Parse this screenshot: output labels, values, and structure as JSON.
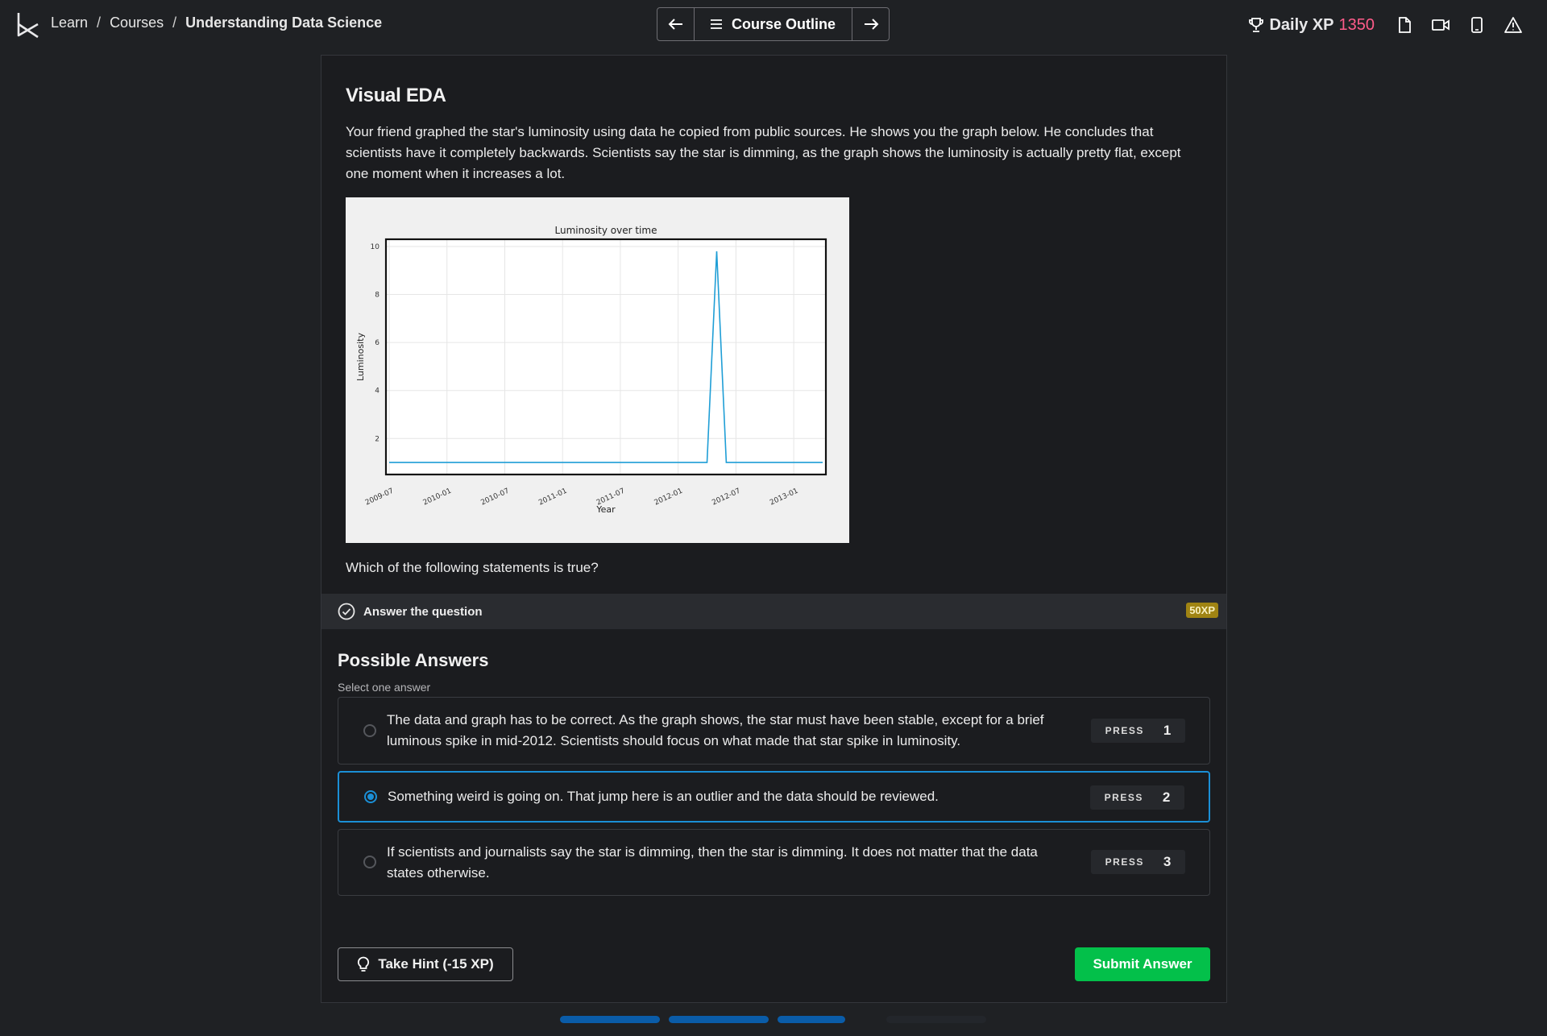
{
  "breadcrumb": {
    "items": [
      "Learn",
      "Courses"
    ],
    "current": "Understanding Data Science",
    "separator": "/"
  },
  "nav": {
    "outline_label": "Course Outline",
    "prev": "←",
    "next": "→"
  },
  "xp": {
    "label": "Daily XP",
    "value": "1350"
  },
  "exercise": {
    "title": "Visual EDA",
    "description": "Your friend graphed the star's luminosity using data he copied from public sources. He shows you the graph below. He concludes that scientists have it completely backwards. Scientists say the star is dimming, as the graph shows the luminosity is actually pretty flat, except one moment when it increases a lot.",
    "question": "Which of the following statements is true?"
  },
  "task": {
    "label": "Answer the question",
    "xp": "50XP"
  },
  "answers_section": {
    "title": "Possible Answers",
    "subtitle": "Select one answer"
  },
  "answers": [
    {
      "text": "The data and graph has to be correct. As the graph shows, the star must have been stable, except for a brief luminous spike in mid-2012. Scientists should focus on what made that star spike in luminosity.",
      "press": "PRESS",
      "key": "1",
      "selected": false
    },
    {
      "text": "Something weird is going on. That jump here is an outlier and the data should be reviewed.",
      "press": "PRESS",
      "key": "2",
      "selected": true
    },
    {
      "text": "If scientists and journalists say the star is dimming, then the star is dimming. It does not matter that the data states otherwise.",
      "press": "PRESS",
      "key": "3",
      "selected": false
    }
  ],
  "buttons": {
    "hint": "Take Hint (-15 XP)",
    "submit": "Submit Answer"
  },
  "progress": {
    "completed_segments": 3,
    "total_segments": 4,
    "color": "#0a5ca8"
  },
  "colors": {
    "accent": "#1b8fd6",
    "submit": "#03c04a",
    "xp_number": "#ff5c8a",
    "xp_badge": "#a08413"
  },
  "chart_data": {
    "type": "line",
    "title": "Luminosity over time",
    "xlabel": "Year",
    "ylabel": "Luminosity",
    "x_ticks": [
      "2009-07",
      "2010-01",
      "2010-07",
      "2011-01",
      "2011-07",
      "2012-01",
      "2012-07",
      "2013-01"
    ],
    "y_ticks": [
      2,
      4,
      6,
      8,
      10
    ],
    "ylim": [
      0.5,
      10.3
    ],
    "xlim": [
      "2009-07",
      "2013-04"
    ],
    "grid": true,
    "series": [
      {
        "color": "#1f9ed6",
        "x": [
          "2009-07",
          "2010-01",
          "2010-07",
          "2011-01",
          "2011-07",
          "2012-01",
          "2012-04",
          "2012-05",
          "2012-06",
          "2013-01",
          "2013-04"
        ],
        "y": [
          1.0,
          1.0,
          1.0,
          1.0,
          1.0,
          1.0,
          1.0,
          9.8,
          1.0,
          1.0,
          1.0
        ]
      }
    ]
  }
}
